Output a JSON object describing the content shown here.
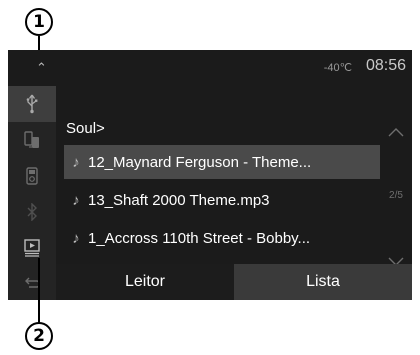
{
  "callouts": [
    {
      "number": "1"
    },
    {
      "number": "2"
    }
  ],
  "status_bar": {
    "temperature": "-40℃",
    "time": "08:56"
  },
  "sidebar": {
    "items": [
      {
        "icon": "usb-icon",
        "active": true
      },
      {
        "icon": "phone-transfer-icon",
        "active": false
      },
      {
        "icon": "ipod-icon",
        "active": false
      },
      {
        "icon": "bluetooth-icon",
        "active": false
      },
      {
        "icon": "video-playlist-icon",
        "active": false
      },
      {
        "icon": "back-icon",
        "active": false
      }
    ]
  },
  "browser": {
    "folder": "Soul>",
    "items": [
      {
        "label": "12_Maynard Ferguson - Theme...",
        "selected": true
      },
      {
        "label": "13_Shaft 2000 Theme.mp3",
        "selected": false
      },
      {
        "label": "1_Accross 110th Street - Bobby...",
        "selected": false
      }
    ],
    "page_indicator": "2/5"
  },
  "tabs": [
    {
      "label": "Leitor",
      "active": false
    },
    {
      "label": "Lista",
      "active": true
    }
  ]
}
